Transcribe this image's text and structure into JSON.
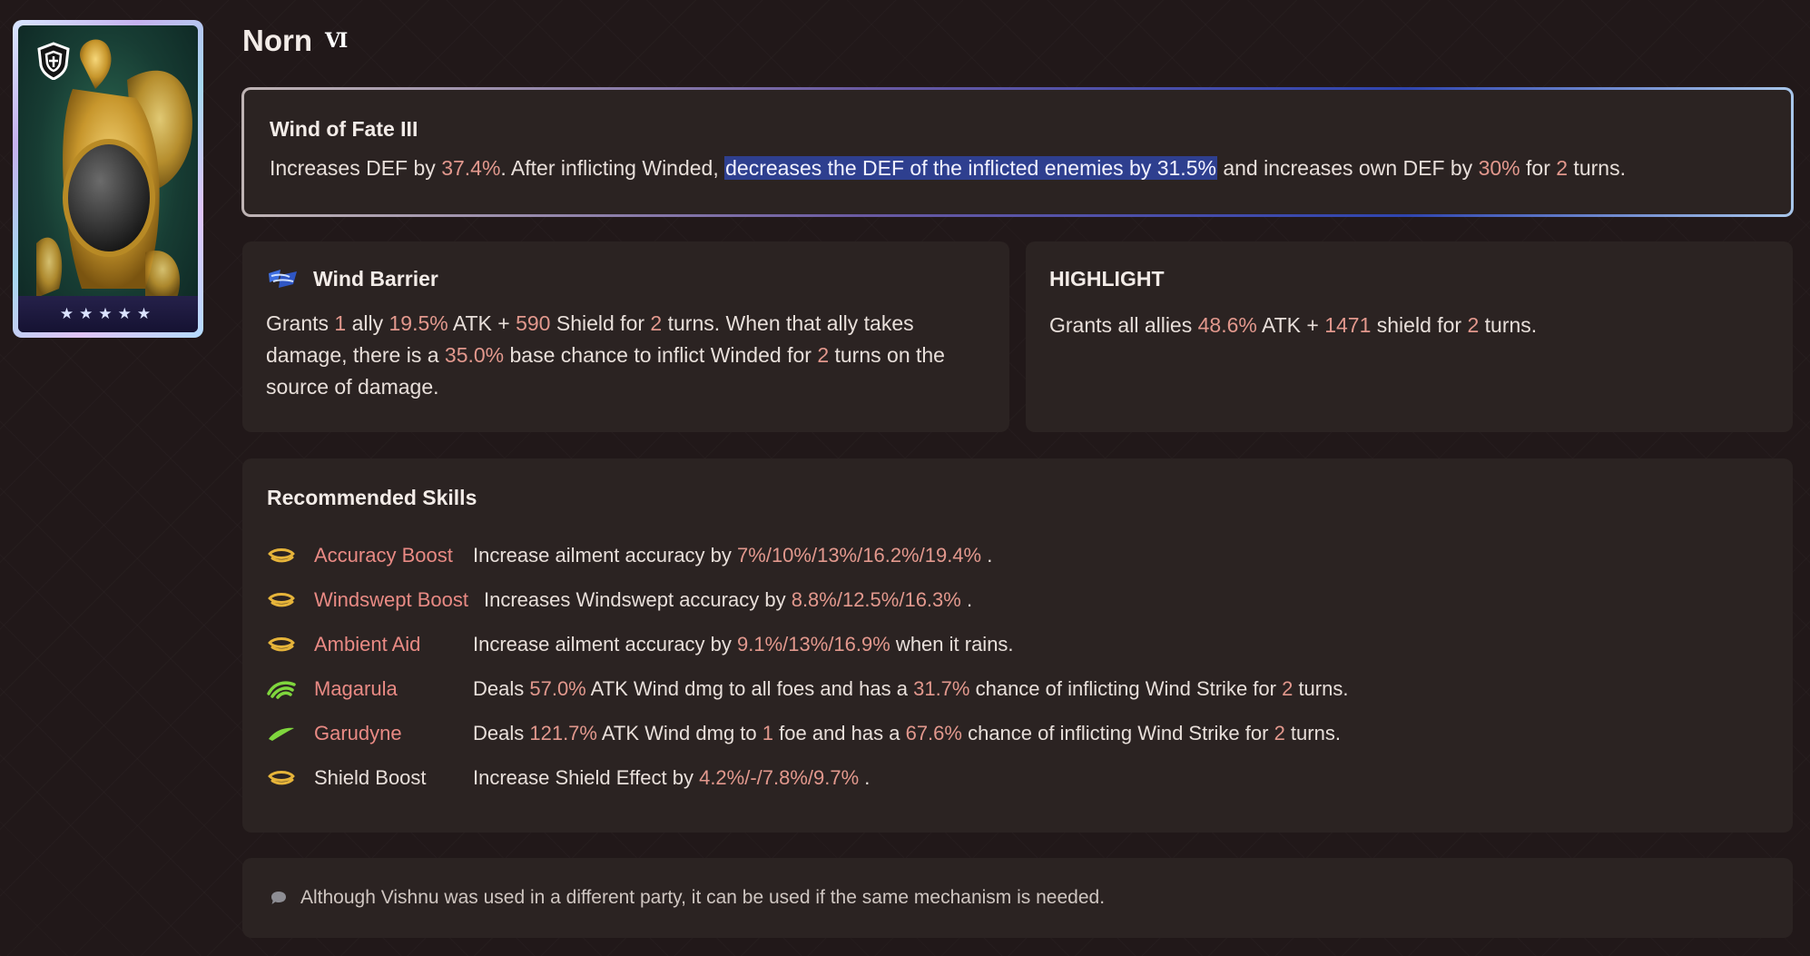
{
  "card": {
    "stars": "★★★★★"
  },
  "header": {
    "name": "Norn",
    "rank": "Ⅵ"
  },
  "unique_skill": {
    "title": "Wind of Fate III",
    "text_1": "Increases DEF by ",
    "v1": "37.4%",
    "text_2": ". After inflicting Winded, ",
    "selected": "decreases the DEF of the inflicted enemies by 31.5%",
    "text_3": " and increases own DEF by ",
    "v2": "30%",
    "text_4": " for ",
    "v3": "2",
    "text_5": " turns."
  },
  "wind_barrier": {
    "title": "Wind Barrier",
    "t1": "Grants ",
    "v1": "1",
    "t2": " ally ",
    "v2": "19.5%",
    "t3": " ATK + ",
    "v3": "590",
    "t4": " Shield for ",
    "v4": "2",
    "t5": " turns. When that ally takes damage, there is a ",
    "v5": "35.0%",
    "t6": " base chance to inflict Winded for ",
    "v6": "2",
    "t7": " turns on the source of damage."
  },
  "highlight": {
    "title": "HIGHLIGHT",
    "t1": "Grants all allies ",
    "v1": "48.6%",
    "t2": " ATK + ",
    "v2": "1471",
    "t3": " shield for ",
    "v3": "2",
    "t4": " turns."
  },
  "recommended": {
    "title": "Recommended Skills",
    "skills": [
      {
        "icon": "passive-icon",
        "name": "Accuracy Boost",
        "d1": "Increase ailment accuracy by ",
        "v1": "7%/10%/13%/16.2%/19.4%",
        "d2": " ."
      },
      {
        "icon": "passive-icon",
        "name": "Windswept Boost",
        "d1": "Increases Windswept accuracy by ",
        "v1": "8.8%/12.5%/16.3%",
        "d2": " ."
      },
      {
        "icon": "passive-icon",
        "name": "Ambient Aid",
        "d1": "Increase ailment accuracy by ",
        "v1": "9.1%/13%/16.9%",
        "d2": " when it rains."
      },
      {
        "icon": "wind-icon",
        "name": "Magarula",
        "d1": "Deals ",
        "v1": "57.0%",
        "d2": " ATK Wind dmg to all foes and has a ",
        "v3": "31.7%",
        "d3": " chance of inflicting Wind Strike for ",
        "v4": "2",
        "d4": " turns."
      },
      {
        "icon": "wind-icon",
        "name": "Garudyne",
        "d1": "Deals ",
        "v1": "121.7%",
        "d2": " ATK Wind dmg to ",
        "v2": "1",
        "d2b": " foe and has a ",
        "v3": "67.6%",
        "d3": " chance of inflicting Wind Strike for ",
        "v4": "2",
        "d4": " turns."
      },
      {
        "icon": "passive-icon",
        "name": "Shield Boost",
        "d1": "Increase Shield Effect by ",
        "v1": "4.2%/-/7.8%/9.7%",
        "d2": " ."
      }
    ]
  },
  "note": {
    "text": "Although Vishnu was used in a different party, it can be used if the same mechanism is needed."
  },
  "colors": {
    "background": "#211819",
    "panel": "#2b2322",
    "value_highlight": "#e2988d",
    "skill_name": "#e98a84",
    "selection": "#2e3f8f"
  }
}
